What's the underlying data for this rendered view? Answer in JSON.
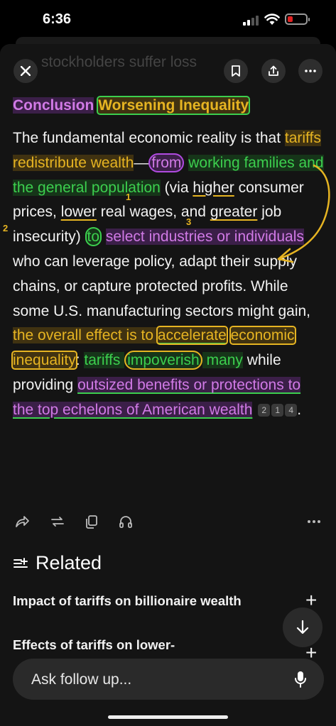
{
  "status_bar": {
    "time": "6:36"
  },
  "ghost": {
    "text": "stockholders suffer loss"
  },
  "article": {
    "heading_part1": "Conclusion",
    "heading_part2": "Worsening Inequality",
    "para": {
      "s1": "The fundamental economic reality is that ",
      "s2": "tariffs redistribute wealth",
      "s3": "—",
      "s4": "from",
      "s5": " ",
      "s6": "working families and the general population",
      "s7": " (via ",
      "s8": "higher",
      "s9": " consumer prices, ",
      "s10": "lower",
      "s11": " real wages, and ",
      "s12": "greater",
      "s13": " job insecurity) ",
      "s14": "to",
      "s15": " ",
      "s16": "select industries or individuals",
      "s17": " who can leverage policy, adapt their supply chains, or capture protected profits. While some U.S. manufacturing sectors might gain, ",
      "s18": "the overall effect is to ",
      "s19": "accelerate",
      "s20": " ",
      "s21": "economic inequality",
      "s22": ": ",
      "s23": "tariffs ",
      "s24": "impoverish",
      "s25": " many",
      "s26": " while providing ",
      "s27": "outsized benefits or protections to the top echelons of American wealth",
      "s28": "."
    },
    "citations": [
      "2",
      "1",
      "4"
    ]
  },
  "annotations": {
    "n1": "1",
    "n2": "2",
    "n3": "3"
  },
  "related": {
    "title": "Related",
    "items": [
      {
        "label": "Impact of tariffs on billionaire wealth"
      },
      {
        "label": "Effects of tariffs on lower-"
      }
    ]
  },
  "ask": {
    "placeholder": "Ask follow up..."
  },
  "colors": {
    "purple": "#d17ae6",
    "yellow": "#e6b422",
    "green": "#3ccf4e"
  }
}
